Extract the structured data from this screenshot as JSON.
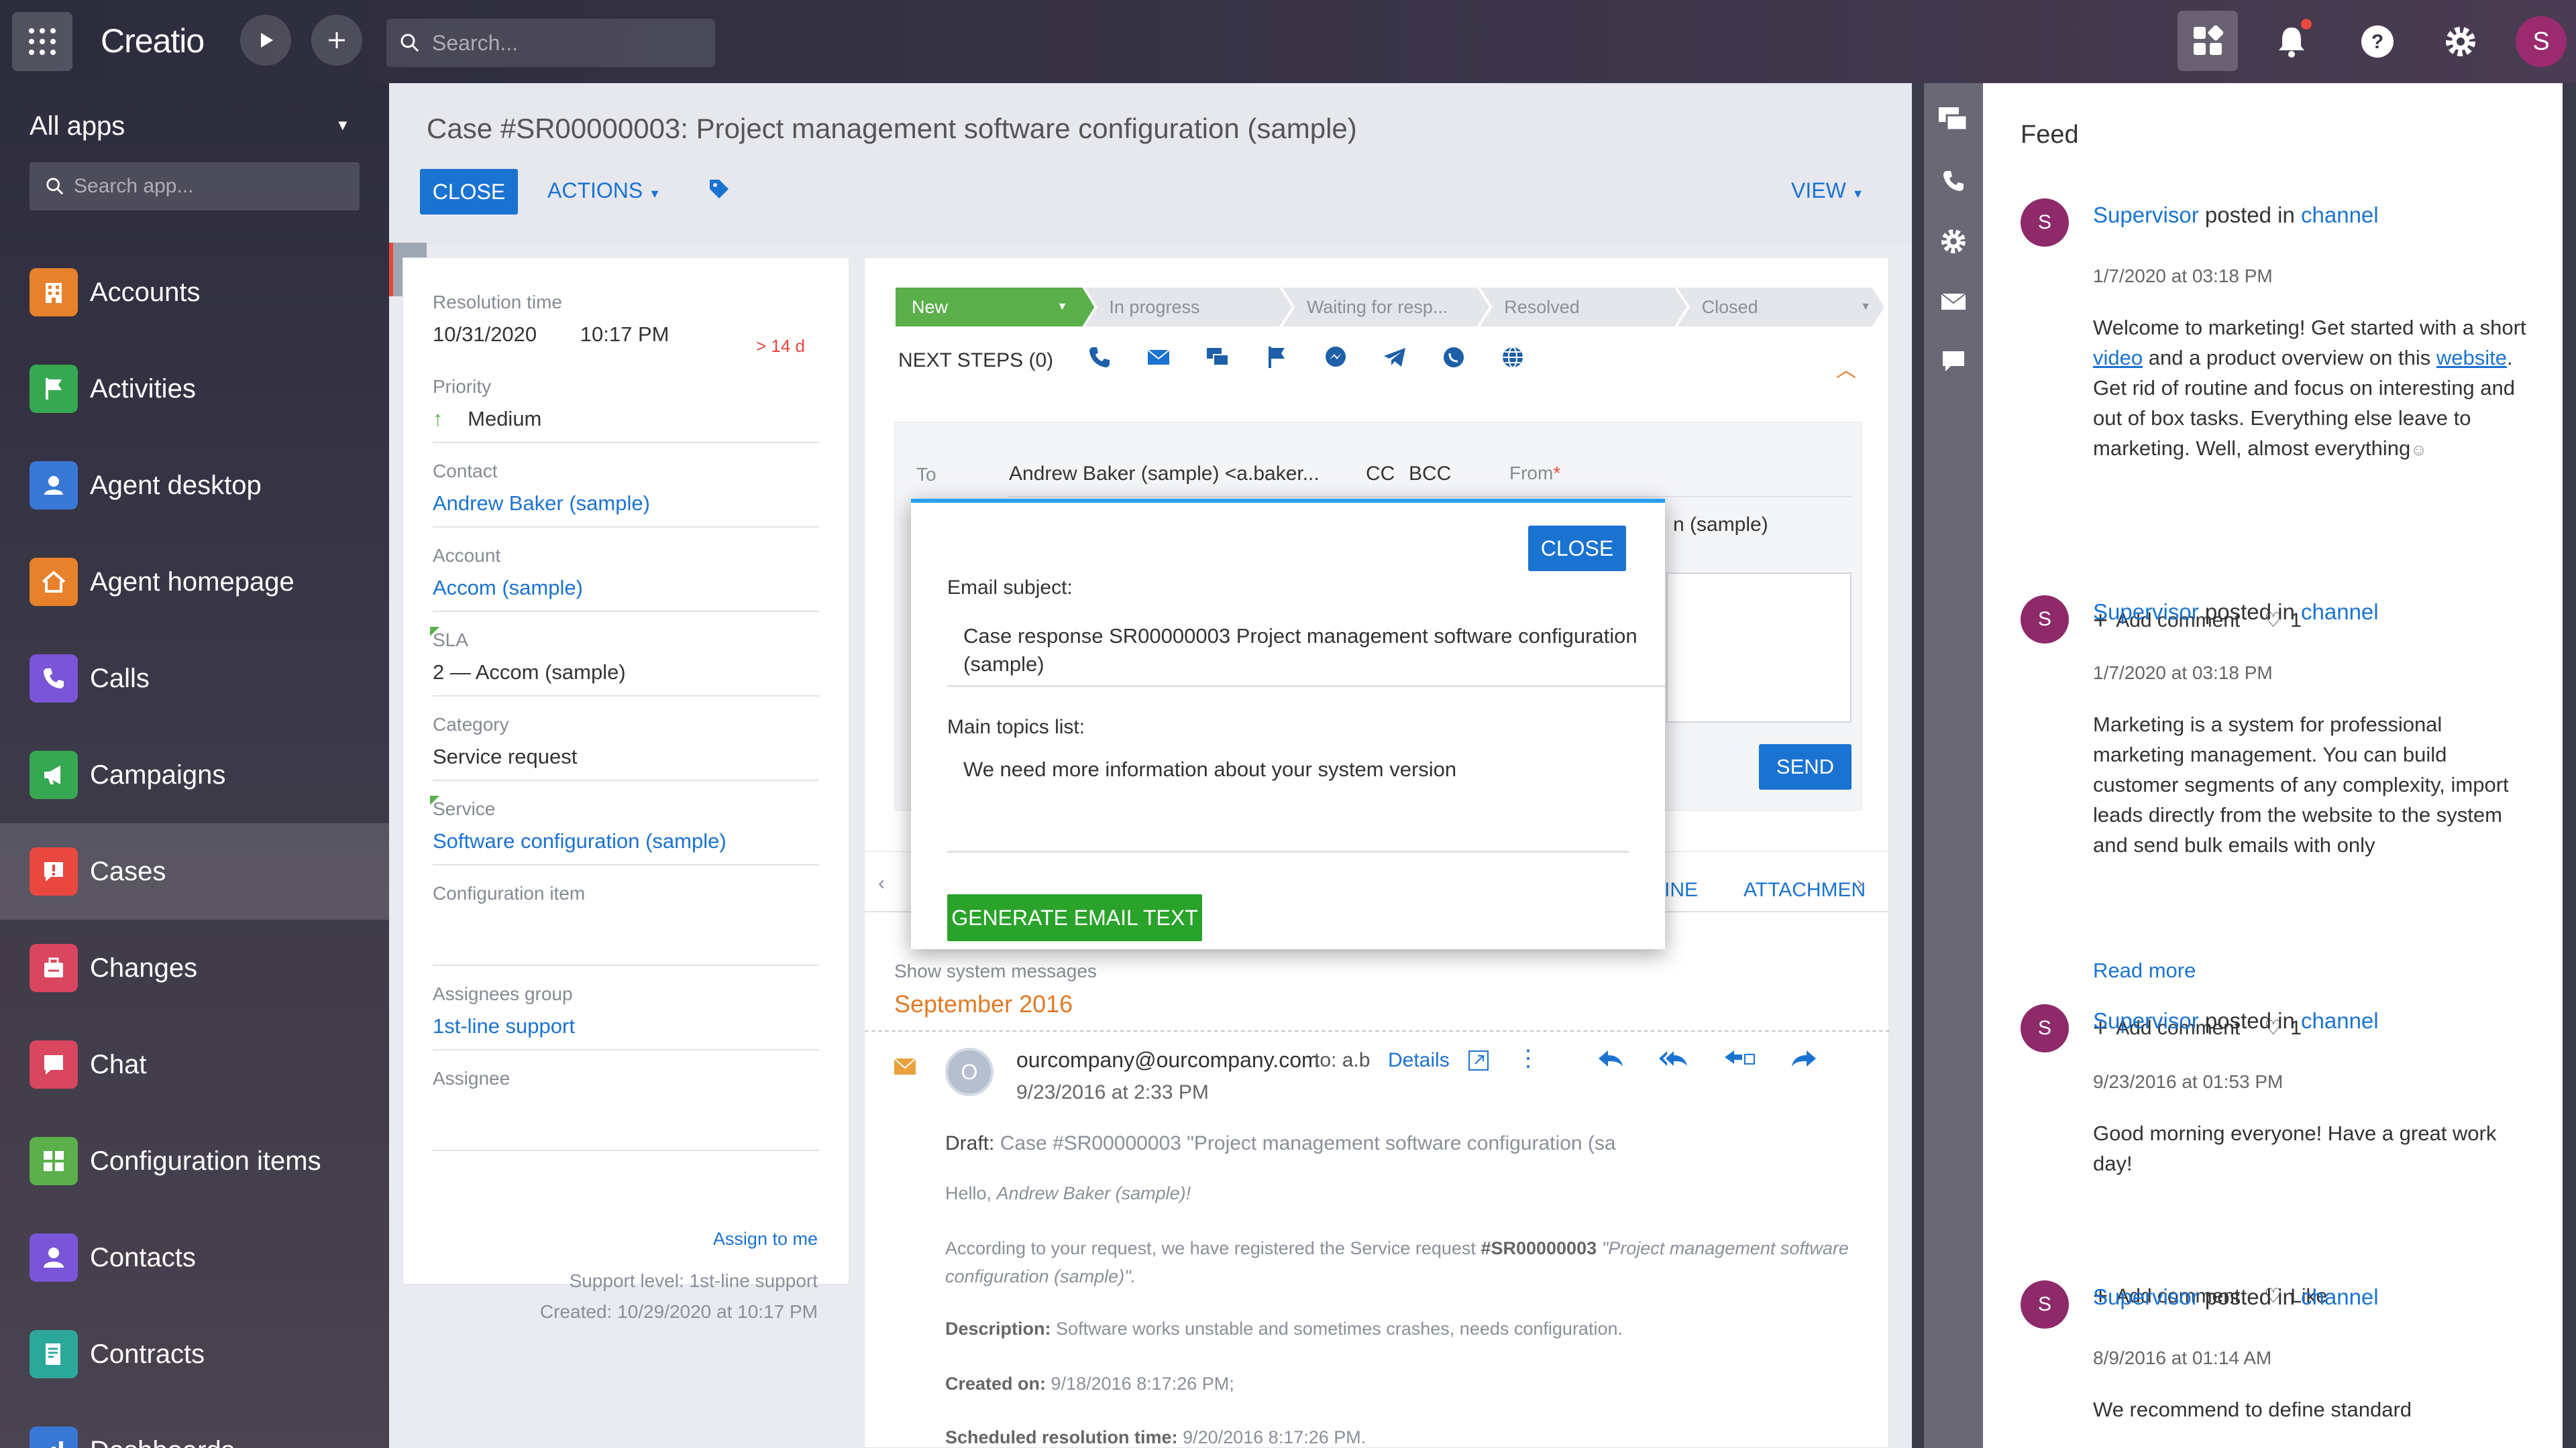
{
  "topbar": {
    "logo": "Creatio",
    "search_placeholder": "Search..."
  },
  "sidebar": {
    "all_apps": "All apps",
    "search_placeholder": "Search app...",
    "items": [
      {
        "label": "Accounts",
        "icon": "accounts-icon",
        "color": "#e8812c"
      },
      {
        "label": "Activities",
        "icon": "flag-icon",
        "color": "#36a852"
      },
      {
        "label": "Agent desktop",
        "icon": "agent-desktop-icon",
        "color": "#3a78d6"
      },
      {
        "label": "Agent homepage",
        "icon": "home-icon",
        "color": "#e8812c"
      },
      {
        "label": "Calls",
        "icon": "phone-icon",
        "color": "#7a55d9"
      },
      {
        "label": "Campaigns",
        "icon": "megaphone-icon",
        "color": "#36a852"
      },
      {
        "label": "Cases",
        "icon": "cases-icon",
        "color": "#e8483f"
      },
      {
        "label": "Changes",
        "icon": "changes-icon",
        "color": "#d9465f"
      },
      {
        "label": "Chat",
        "icon": "chat-icon",
        "color": "#d9465f"
      },
      {
        "label": "Configuration items",
        "icon": "config-items-icon",
        "color": "#5bb04b"
      },
      {
        "label": "Contacts",
        "icon": "contact-icon",
        "color": "#7a55d9"
      },
      {
        "label": "Contracts",
        "icon": "contract-icon",
        "color": "#2ca89a"
      },
      {
        "label": "Dashboards",
        "icon": "dashboard-icon",
        "color": "#3a78d6"
      }
    ]
  },
  "case": {
    "title": "Case #SR00000003: Project management software configuration (sample)",
    "close_label": "CLOSE",
    "actions_label": "ACTIONS",
    "view_label": "VIEW"
  },
  "info": {
    "resolution_label": "Resolution time",
    "resolution_date": "10/31/2020",
    "resolution_time": "10:17 PM",
    "late_badge": "> 14 d",
    "priority_label": "Priority",
    "priority_value": "Medium",
    "contact_label": "Contact",
    "contact_value": "Andrew Baker (sample)",
    "account_label": "Account",
    "account_value": "Accom (sample)",
    "sla_label": "SLA",
    "sla_value": "2 — Accom (sample)",
    "category_label": "Category",
    "category_value": "Service request",
    "service_label": "Service",
    "service_value": "Software configuration (sample)",
    "config_item_label": "Configuration item",
    "config_item_value": "",
    "assignees_group_label": "Assignees group",
    "assignees_group_value": "1st-line support",
    "assignee_label": "Assignee",
    "assignee_value": "",
    "assign_to_me": "Assign to me",
    "support_level": "Support level: 1st-line support",
    "created": "Created: 10/29/2020 at 10:17 PM"
  },
  "workflow": {
    "stages": [
      "New",
      "In progress",
      "Waiting for resp...",
      "Resolved",
      "Closed"
    ],
    "next_steps": "NEXT STEPS (0)"
  },
  "compose": {
    "to_label": "To",
    "to_value": "Andrew Baker (sample) <a.baker...",
    "cc": "CC",
    "bcc": "BCC",
    "from_label": "From",
    "from_value": "n (sample)",
    "send_label": "SEND"
  },
  "history": {
    "tab_timeline": "INE",
    "tab_attachments": "ATTACHMEN",
    "show_system": "Show system messages",
    "month": "September 2016",
    "sender": "ourcompany@ourcompany.com",
    "to_short": "to: a.b",
    "details": "Details",
    "date": "9/23/2016 at 2:33 PM",
    "draft_label": "Draft:",
    "draft_text": "Case #SR00000003 \"Project management software configuration (sa",
    "hello_prefix": "Hello,",
    "hello_name": "Andrew Baker (sample)!",
    "body_intro": "According to your request, we have registered the Service request",
    "body_case": "#SR00000003",
    "body_case_name": "\"Project management software configuration (sample)\".",
    "desc_label": "Description:",
    "desc_text": "Software works unstable and sometimes crashes, needs configuration.",
    "created_label": "Created on:",
    "created_text": "9/18/2016 8:17:26 PM;",
    "sched_label": "Scheduled resolution time:",
    "sched_text": "9/20/2016 8:17:26 PM."
  },
  "modal": {
    "close_label": "CLOSE",
    "subject_label": "Email subject:",
    "subject_value": "Case response SR00000003 Project management software configuration (sample)",
    "topics_label": "Main topics list:",
    "topics_value": "We need more information about your system version",
    "generate_label": "GENERATE EMAIL TEXT"
  },
  "feed": {
    "title": "Feed",
    "posts": [
      {
        "avatar": "S",
        "author": "Supervisor",
        "posted_in": "posted in",
        "channel": "channel",
        "date": "1/7/2020 at 03:18 PM",
        "text_1": "Welcome to marketing! Get started with a short",
        "link_1": "video",
        "text_2": "and a product overview on this",
        "link_2": "website",
        "text_3": ". Get rid of routine and focus on interesting and out of box tasks. Everything else leave to marketing. Well, almost everything",
        "add_comment": "Add comment",
        "likes": "1"
      },
      {
        "avatar": "S",
        "author": "Supervisor",
        "posted_in": "posted in",
        "channel": "channel",
        "date": "1/7/2020 at 03:18 PM",
        "text": "Marketing is a system for professional marketing management. You can build customer segments of any complexity, import leads directly from the website to the system and send bulk emails with only",
        "read_more": "Read more",
        "add_comment": "Add comment",
        "likes": "1"
      },
      {
        "avatar": "S",
        "author": "Supervisor",
        "posted_in": "posted in",
        "channel": "channel",
        "date": "9/23/2016 at 01:53 PM",
        "text": "Good morning everyone! Have a great work day!",
        "add_comment": "Add comment",
        "likes": "Like"
      },
      {
        "avatar": "S",
        "author": "Supervisor",
        "posted_in": "posted in",
        "channel": "channel",
        "date": "8/9/2016 at 01:14 AM",
        "text": "We recommend to define standard"
      }
    ]
  },
  "colors": {
    "accent": "#1b73d1",
    "stage_active": "#5bb04b",
    "generate": "#2aa32a",
    "month": "#e07a24"
  }
}
